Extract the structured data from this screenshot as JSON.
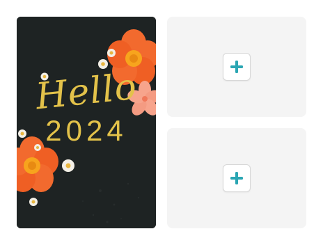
{
  "card": {
    "greeting": "Hello",
    "year": "2024",
    "background_color": "#1e2323",
    "text_color": "#e3c24a",
    "flower_color": "#f26a2e",
    "accent_pink": "#f7a48c"
  },
  "slots": [
    {
      "button_icon": "plus-icon"
    },
    {
      "button_icon": "plus-icon"
    }
  ],
  "accent_color": "#2aa6b3"
}
